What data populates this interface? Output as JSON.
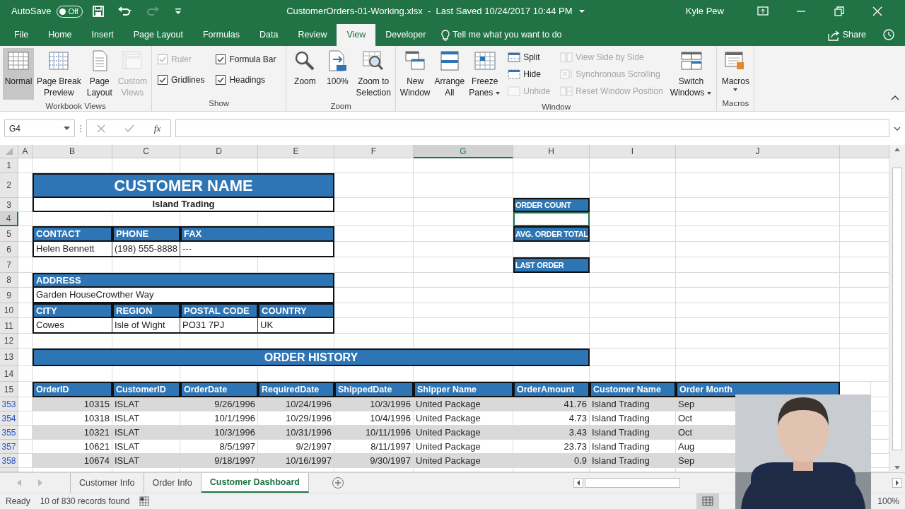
{
  "title_bar": {
    "autosave": {
      "label": "AutoSave",
      "state_text": "Off",
      "on": false
    },
    "quick_access": [
      {
        "disabled": false
      },
      {
        "disabled": false
      },
      {
        "disabled": true
      },
      {
        "disabled": false
      }
    ],
    "file_title": "CustomerOrders-01-Working.xlsx  -  Last Saved 10/24/2017 10:44 PM",
    "user": "Kyle Pew"
  },
  "menu_tabs": [
    {
      "label": "File",
      "selected": false
    },
    {
      "label": "Home",
      "selected": false
    },
    {
      "label": "Insert",
      "selected": false
    },
    {
      "label": "Page Layout",
      "selected": false
    },
    {
      "label": "Formulas",
      "selected": false
    },
    {
      "label": "Data",
      "selected": false
    },
    {
      "label": "Review",
      "selected": false
    },
    {
      "label": "View",
      "selected": true
    },
    {
      "label": "Developer",
      "selected": false
    }
  ],
  "tell_me": "Tell me what you want to do",
  "share": "Share",
  "ribbon_groups": [
    {
      "label": "Workbook Views",
      "items": [
        {
          "kind": "large",
          "lines": [
            "Normal"
          ],
          "selected": true,
          "disabled": false,
          "dropdown": false
        },
        {
          "kind": "large",
          "lines": [
            "Page Break",
            "Preview"
          ],
          "selected": false,
          "disabled": false,
          "dropdown": false
        },
        {
          "kind": "large",
          "lines": [
            "Page",
            "Layout"
          ],
          "selected": false,
          "disabled": false,
          "dropdown": false
        },
        {
          "kind": "large",
          "lines": [
            "Custom",
            "Views"
          ],
          "selected": false,
          "disabled": true,
          "dropdown": false
        }
      ]
    },
    {
      "label": "Show",
      "items": [
        {
          "kind": "column",
          "items": [
            {
              "kind": "check",
              "label": "Ruler",
              "checked": true,
              "disabled": true
            },
            {
              "kind": "check",
              "label": "Gridlines",
              "checked": true,
              "disabled": false
            }
          ]
        },
        {
          "kind": "column",
          "items": [
            {
              "kind": "check",
              "label": "Formula Bar",
              "checked": true,
              "disabled": false
            },
            {
              "kind": "check",
              "label": "Headings",
              "checked": true,
              "disabled": false
            }
          ]
        }
      ]
    },
    {
      "label": "Zoom",
      "items": [
        {
          "kind": "large",
          "lines": [
            "Zoom"
          ],
          "selected": false,
          "disabled": false,
          "dropdown": false
        },
        {
          "kind": "large",
          "lines": [
            "100%"
          ],
          "selected": false,
          "disabled": false,
          "dropdown": false
        },
        {
          "kind": "large",
          "lines": [
            "Zoom to",
            "Selection"
          ],
          "selected": false,
          "disabled": false,
          "dropdown": false
        }
      ]
    },
    {
      "label": "Window",
      "items": [
        {
          "kind": "large",
          "lines": [
            "New",
            "Window"
          ],
          "selected": false,
          "disabled": false,
          "dropdown": false
        },
        {
          "kind": "large",
          "lines": [
            "Arrange",
            "All"
          ],
          "selected": false,
          "disabled": false,
          "dropdown": false
        },
        {
          "kind": "large",
          "lines": [
            "Freeze",
            "Panes"
          ],
          "selected": false,
          "disabled": false,
          "dropdown": true
        },
        {
          "kind": "column",
          "items": [
            {
              "kind": "small",
              "label": "Split",
              "disabled": false
            },
            {
              "kind": "small",
              "label": "Hide",
              "disabled": false
            },
            {
              "kind": "small",
              "label": "Unhide",
              "disabled": true
            }
          ]
        },
        {
          "kind": "column",
          "items": [
            {
              "kind": "small",
              "label": "View Side by Side",
              "disabled": true
            },
            {
              "kind": "small",
              "label": "Synchronous Scrolling",
              "disabled": true
            },
            {
              "kind": "small",
              "label": "Reset Window Position",
              "disabled": true
            }
          ]
        },
        {
          "kind": "large",
          "lines": [
            "Switch",
            "Windows"
          ],
          "selected": false,
          "disabled": false,
          "dropdown": true
        }
      ]
    },
    {
      "label": "Macros",
      "items": [
        {
          "kind": "large",
          "lines": [
            "Macros"
          ],
          "selected": false,
          "disabled": false,
          "dropdown": true
        }
      ]
    }
  ],
  "formula_bar": {
    "name_box": "G4",
    "fx": "fx"
  },
  "column_headers": [
    {
      "label": "A",
      "selected": false
    },
    {
      "label": "B",
      "selected": false
    },
    {
      "label": "C",
      "selected": false
    },
    {
      "label": "D",
      "selected": false
    },
    {
      "label": "E",
      "selected": false
    },
    {
      "label": "F",
      "selected": false
    },
    {
      "label": "G",
      "selected": true
    },
    {
      "label": "H",
      "selected": false
    },
    {
      "label": "I",
      "selected": false
    },
    {
      "label": "J",
      "selected": false
    }
  ],
  "row_headers": [
    {
      "label": "1",
      "selected": false,
      "filtered": false
    },
    {
      "label": "2",
      "selected": false,
      "filtered": false
    },
    {
      "label": "3",
      "selected": false,
      "filtered": false
    },
    {
      "label": "4",
      "selected": true,
      "filtered": false
    },
    {
      "label": "5",
      "selected": false,
      "filtered": false
    },
    {
      "label": "6",
      "selected": false,
      "filtered": false
    },
    {
      "label": "7",
      "selected": false,
      "filtered": false
    },
    {
      "label": "8",
      "selected": false,
      "filtered": false
    },
    {
      "label": "9",
      "selected": false,
      "filtered": false
    },
    {
      "label": "10",
      "selected": false,
      "filtered": false
    },
    {
      "label": "11",
      "selected": false,
      "filtered": false
    },
    {
      "label": "12",
      "selected": false,
      "filtered": false
    },
    {
      "label": "13",
      "selected": false,
      "filtered": false
    },
    {
      "label": "14",
      "selected": false,
      "filtered": false
    },
    {
      "label": "15",
      "selected": false,
      "filtered": false
    },
    {
      "label": "353",
      "selected": false,
      "filtered": true
    },
    {
      "label": "354",
      "selected": false,
      "filtered": true
    },
    {
      "label": "355",
      "selected": false,
      "filtered": true
    },
    {
      "label": "357",
      "selected": false,
      "filtered": true
    },
    {
      "label": "358",
      "selected": false,
      "filtered": true
    }
  ],
  "customer_panel": {
    "title": "CUSTOMER NAME",
    "name": "Island Trading",
    "contact_headers": [
      "CONTACT",
      "PHONE",
      "FAX"
    ],
    "contact_values": [
      "Helen Bennett",
      "(198) 555-8888",
      "---"
    ],
    "address_header": "ADDRESS",
    "address": "Garden HouseCrowther Way",
    "location_headers": [
      "CITY",
      "REGION",
      "POSTAL CODE",
      "COUNTRY"
    ],
    "location_values": [
      "Cowes",
      "Isle of Wight",
      "PO31 7PJ",
      "UK"
    ]
  },
  "summary": [
    {
      "label": "ORDER COUNT",
      "selected": true
    },
    {
      "label": "AVG. ORDER TOTAL",
      "selected": false
    },
    {
      "label": "LAST ORDER",
      "selected": false
    }
  ],
  "order_history": {
    "title": "ORDER HISTORY",
    "columns": [
      {
        "label": "OrderID",
        "kind": "number"
      },
      {
        "label": "CustomerID",
        "kind": "text"
      },
      {
        "label": "OrderDate",
        "kind": "number"
      },
      {
        "label": "RequiredDate",
        "kind": "number"
      },
      {
        "label": "ShippedDate",
        "kind": "number"
      },
      {
        "label": "Shipper Name",
        "kind": "text"
      },
      {
        "label": "OrderAmount",
        "kind": "number"
      },
      {
        "label": "Customer Name",
        "kind": "text"
      },
      {
        "label": "Order Month",
        "kind": "text"
      }
    ],
    "rows": [
      {
        "cells": [
          "10315",
          "ISLAT",
          "9/26/1996",
          "10/24/1996",
          "10/3/1996",
          "United Package",
          "41.76",
          "Island Trading",
          "Sep"
        ]
      },
      {
        "cells": [
          "10318",
          "ISLAT",
          "10/1/1996",
          "10/29/1996",
          "10/4/1996",
          "United Package",
          "4.73",
          "Island Trading",
          "Oct"
        ]
      },
      {
        "cells": [
          "10321",
          "ISLAT",
          "10/3/1996",
          "10/31/1996",
          "10/11/1996",
          "United Package",
          "3.43",
          "Island Trading",
          "Oct"
        ]
      },
      {
        "cells": [
          "10621",
          "ISLAT",
          "8/5/1997",
          "9/2/1997",
          "8/11/1997",
          "United Package",
          "23.73",
          "Island Trading",
          "Aug"
        ]
      },
      {
        "cells": [
          "10674",
          "ISLAT",
          "9/18/1997",
          "10/16/1997",
          "9/30/1997",
          "United Package",
          "0.9",
          "Island Trading",
          "Sep"
        ]
      }
    ]
  },
  "sheet_tabs": [
    {
      "label": "Customer Info",
      "selected": false
    },
    {
      "label": "Order Info",
      "selected": false
    },
    {
      "label": "Customer Dashboard",
      "selected": true
    }
  ],
  "status_bar": {
    "ready": "Ready",
    "records": "10 of 830 records found",
    "views": [
      {
        "selected": true
      }
    ],
    "zoom": "100%"
  }
}
